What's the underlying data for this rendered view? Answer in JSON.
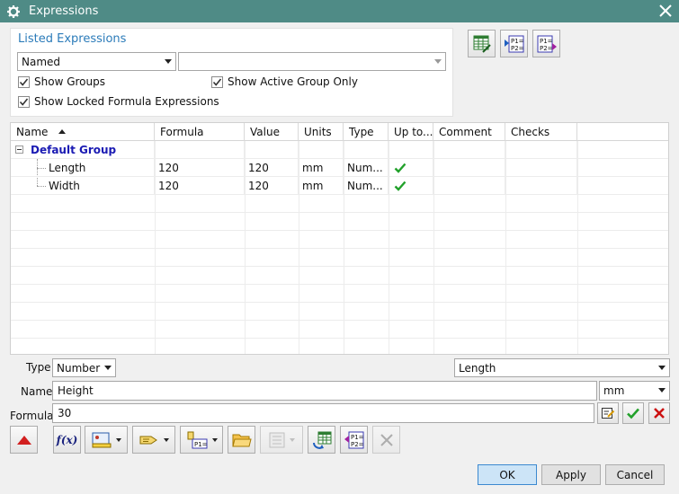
{
  "window": {
    "title": "Expressions",
    "icons": {
      "app": "gear-icon",
      "close": "close-icon"
    }
  },
  "listed": {
    "title": "Listed Expressions",
    "filter_value": "Named",
    "group_value": "",
    "show_groups": {
      "label": "Show Groups",
      "checked": true
    },
    "show_active_group_only": {
      "label": "Show Active Group Only",
      "checked": true
    },
    "show_locked": {
      "label": "Show Locked Formula Expressions",
      "checked": true
    }
  },
  "top_buttons": [
    {
      "icon": "spreadsheet-edit-icon"
    },
    {
      "icon": "import-expressions-icon"
    },
    {
      "icon": "export-expressions-icon"
    }
  ],
  "grid": {
    "columns": [
      "Name",
      "Formula",
      "Value",
      "Units",
      "Type",
      "Up to...",
      "Comment",
      "Checks"
    ],
    "group": {
      "name": "Default Group"
    },
    "rows": [
      {
        "name": "Length",
        "formula": "120",
        "value": "120",
        "units": "mm",
        "type": "Num...",
        "up_to_date": true,
        "comment": "",
        "checks": ""
      },
      {
        "name": "Width",
        "formula": "120",
        "value": "120",
        "units": "mm",
        "type": "Num...",
        "up_to_date": true,
        "comment": "",
        "checks": ""
      }
    ]
  },
  "editor": {
    "type_label": "Type",
    "type_value": "Number",
    "dimension_value": "Length",
    "name_label": "Name",
    "name_value": "Height",
    "units_value": "mm",
    "formula_label": "Formula",
    "formula_value": "30"
  },
  "toolbar": [
    {
      "icon": "collapse-up-icon"
    },
    {
      "icon": "function-icon"
    },
    {
      "icon": "measure-icon"
    },
    {
      "icon": "functions-dropdown-icon"
    },
    {
      "icon": "reference-icon"
    },
    {
      "icon": "open-folder-icon"
    },
    {
      "icon": "list-disabled-icon"
    },
    {
      "icon": "refresh-spreadsheet-icon"
    },
    {
      "icon": "import-icon"
    },
    {
      "icon": "delete-icon"
    }
  ],
  "buttons": {
    "ok": "OK",
    "apply": "Apply",
    "cancel": "Cancel"
  },
  "colors": {
    "titlebar": "#4f8b86",
    "accent": "#2b7bb9",
    "check_green": "#22a12b",
    "reject_red": "#cc1111",
    "collapse_red": "#d21f1f"
  }
}
